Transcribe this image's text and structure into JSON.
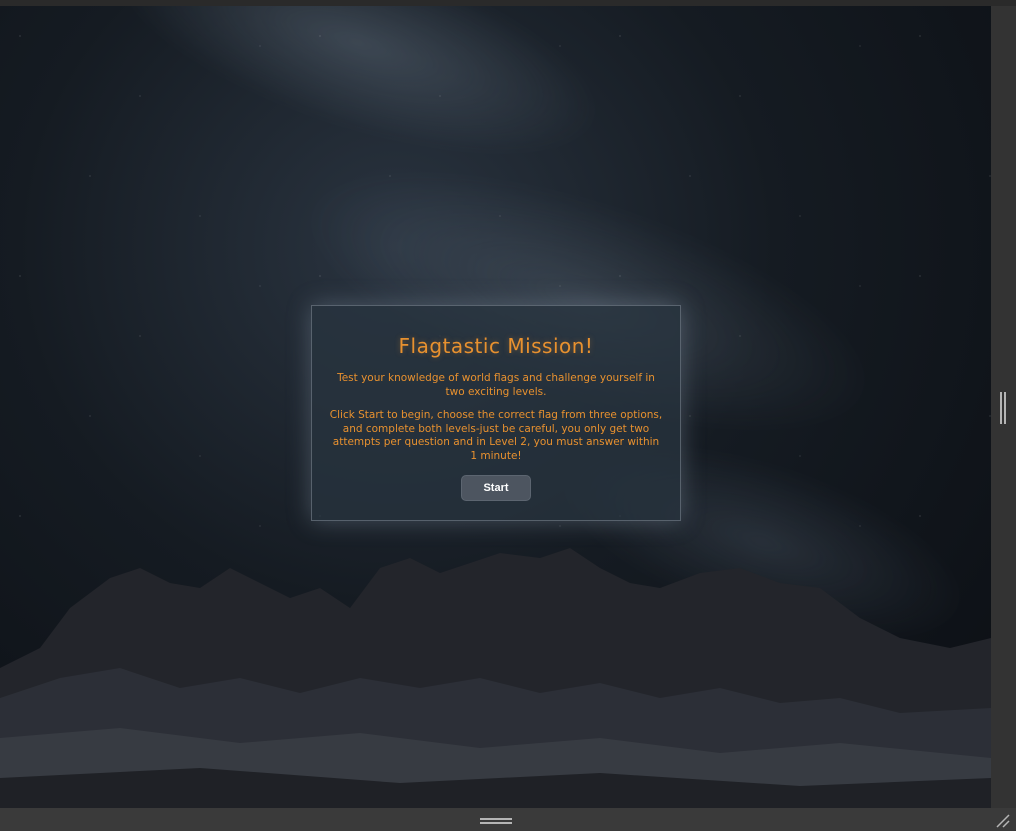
{
  "game": {
    "title": "Flagtastic Mission!",
    "intro": "Test your knowledge of world flags and challenge yourself in two exciting levels.",
    "instructions": "Click Start to begin, choose the correct flag from three options, and complete both levels-just be careful, you only get two attempts per question and in Level 2, you must answer within 1 minute!",
    "start_label": "Start"
  },
  "colors": {
    "accent": "#e8912f",
    "button": "#4d5560",
    "card": "#283440"
  },
  "icons": {
    "vertical_grip": "vertical-resize-grip-icon",
    "horizontal_grip": "horizontal-resize-grip-icon",
    "corner": "resize-corner-icon"
  }
}
